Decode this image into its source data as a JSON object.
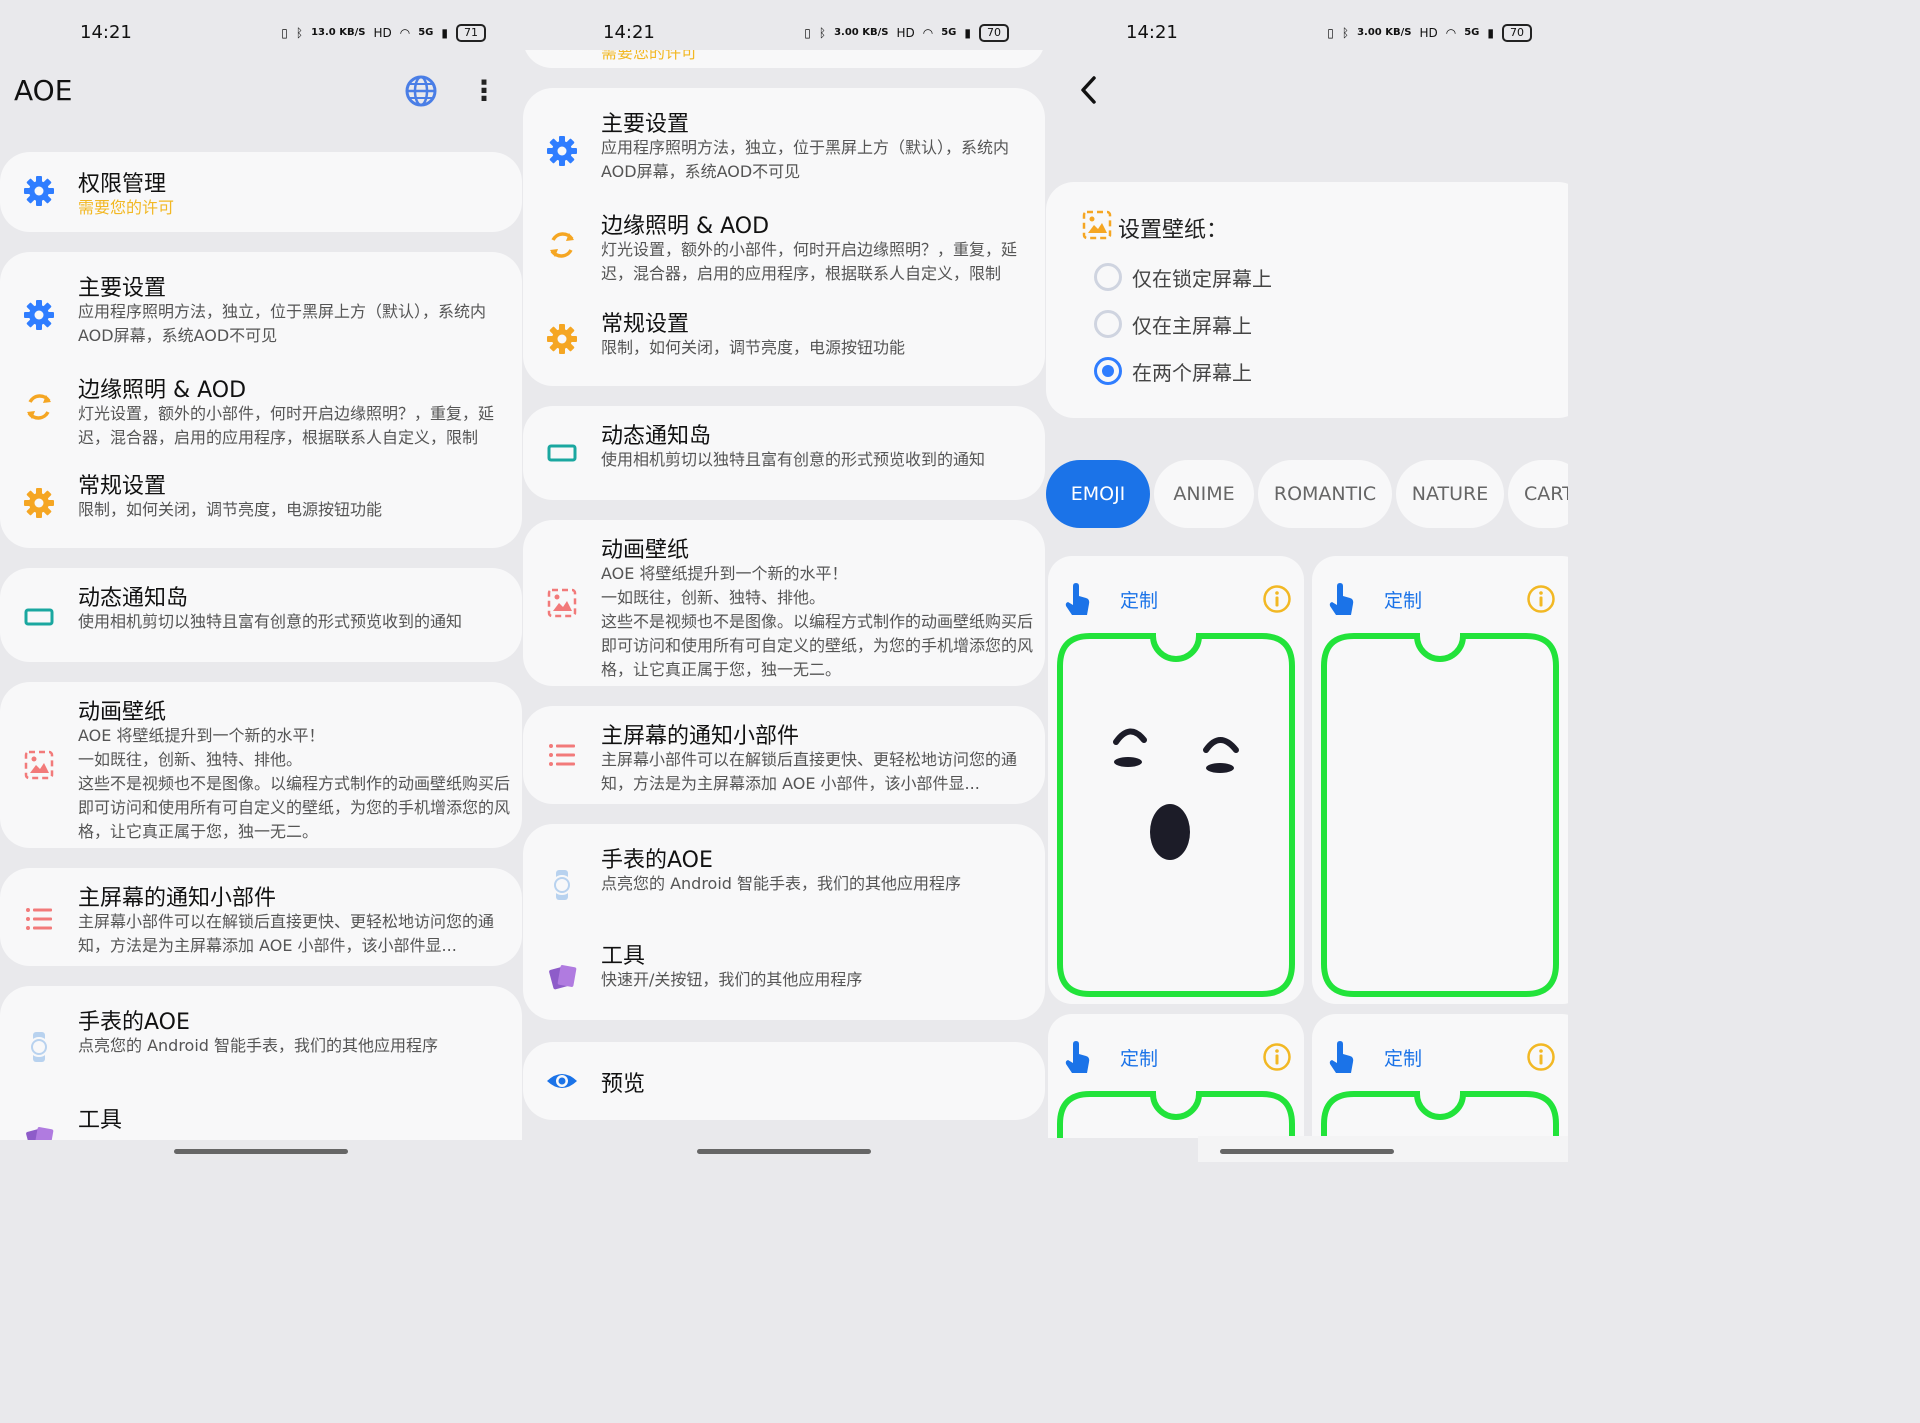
{
  "status": {
    "time": "14:21",
    "net_speed_1": "13.0 KB/S",
    "net_speed_2": "3.00 KB/S",
    "network": "5G",
    "battery_1": "71",
    "battery_2": "70"
  },
  "header": {
    "title": "AOE"
  },
  "items": {
    "permission": {
      "title": "权限管理",
      "desc": "需要您的许可",
      "desc_cut": "需要您的许可"
    },
    "main_settings": {
      "title": "主要设置",
      "desc": "应用程序照明方法，独立，位于黑屏上方（默认），系统内AOD屏幕，系统AOD不可见"
    },
    "edge_lighting": {
      "title": "边缘照明 & AOD",
      "desc": "灯光设置，额外的小部件，何时开启边缘照明？，重复，延迟，混合器，启用的应用程序，根据联系人自定义，限制"
    },
    "general": {
      "title": "常规设置",
      "desc": "限制，如何关闭，调节亮度，电源按钮功能"
    },
    "island": {
      "title": "动态通知岛",
      "desc": "使用相机剪切以独特且富有创意的形式预览收到的通知"
    },
    "wallpaper": {
      "title": "动画壁纸",
      "desc": "AOE 将壁纸提升到一个新的水平！\n一如既往，创新、独特、排他。\n这些不是视频也不是图像。以编程方式制作的动画壁纸购买后即可访问和使用所有可自定义的壁纸，为您的手机增添您的风格，让它真正属于您，独一无二。"
    },
    "widget": {
      "title": "主屏幕的通知小部件",
      "desc": "主屏幕小部件可以在解锁后直接更快、更轻松地访问您的通知，方法是为主屏幕添加 AOE 小部件，该小部件显..."
    },
    "watch": {
      "title": "手表的AOE",
      "desc": "点亮您的 Android 智能手表，我们的其他应用程序"
    },
    "tools": {
      "title": "工具",
      "desc": "快速开/关按钮，我们的其他应用程序"
    },
    "preview": {
      "title": "预览"
    }
  },
  "wallpaper_settings": {
    "title": "设置壁纸：",
    "options": [
      "仅在锁定屏幕上",
      "仅在主屏幕上",
      "在两个屏幕上"
    ],
    "selected_index": 2
  },
  "categories": [
    "EMOJI",
    "ANIME",
    "ROMANTIC",
    "NATURE",
    "CART"
  ],
  "selected_category": "EMOJI",
  "cards": {
    "label": "定制"
  },
  "colors": {
    "accent": "#1b73e8",
    "gear_blue": "#2f7dff",
    "gear_orange": "#f5a623",
    "warn_yellow": "#f2b824",
    "frame_green": "#22e33a",
    "teal": "#1aa7a0",
    "salmon": "#f27a7a"
  }
}
